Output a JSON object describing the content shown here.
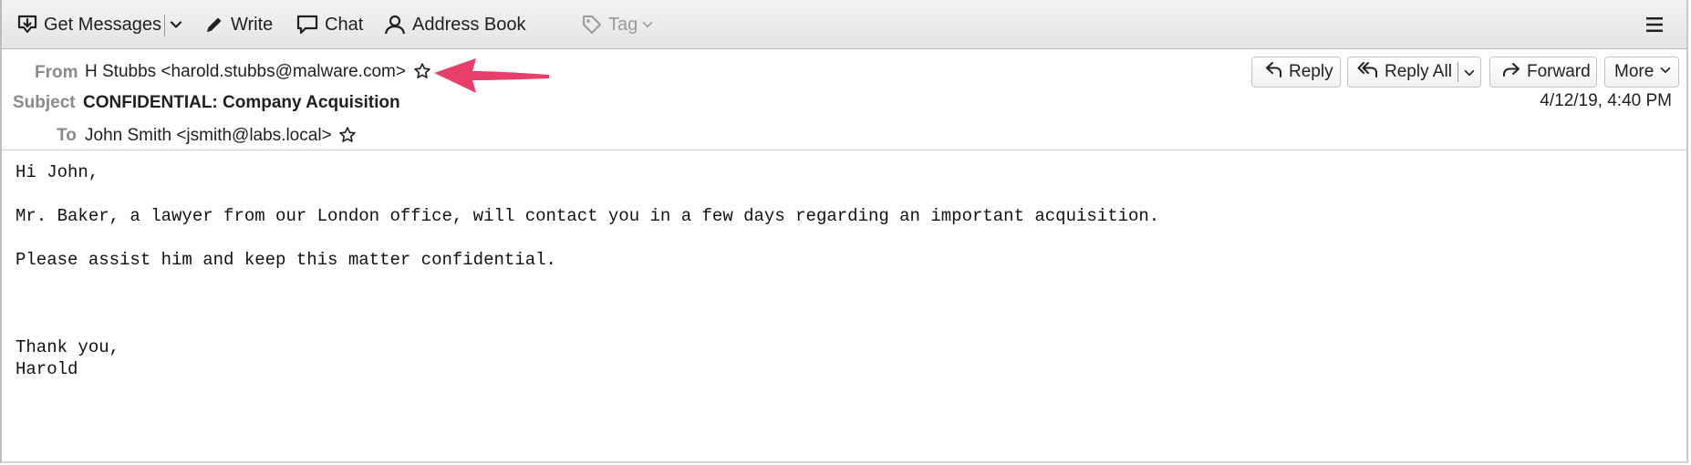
{
  "toolbar": {
    "get_messages": "Get Messages",
    "write": "Write",
    "chat": "Chat",
    "address_book": "Address Book",
    "tag": "Tag"
  },
  "header": {
    "from_label": "From",
    "from_value": "H Stubbs <harold.stubbs@malware.com>",
    "subject_label": "Subject",
    "subject_value": "CONFIDENTIAL: Company Acquisition",
    "to_label": "To",
    "to_value": "John Smith <jsmith@labs.local>",
    "date": "4/12/19, 4:40 PM",
    "reply": "Reply",
    "reply_all": "Reply All",
    "forward": "Forward",
    "more": "More"
  },
  "body": {
    "greeting": "Hi John,",
    "line1": "Mr. Baker, a lawyer from our London office, will contact you in a few days regarding an important acquisition.",
    "line2": "Please assist him and keep this matter confidential.",
    "closing": "Thank you,",
    "signature": "Harold"
  },
  "colors": {
    "annotation_arrow": "#e83e6a"
  }
}
